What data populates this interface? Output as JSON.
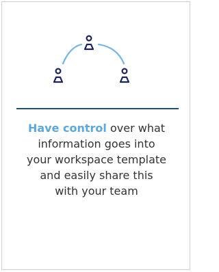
{
  "card": {
    "icon": "team-network-icon",
    "colors": {
      "people": "#1e2357",
      "connector": "#7db6df",
      "divider": "#1f4e6b",
      "highlight": "#5ea8d8",
      "text": "#333333",
      "border": "#cfcfcf"
    },
    "highlight_text": "Have control",
    "body_line1_rest": " over what",
    "body_line2": "information goes into",
    "body_line3": "your workspace template",
    "body_line4": "and easily share this",
    "body_line5": "with your team"
  }
}
